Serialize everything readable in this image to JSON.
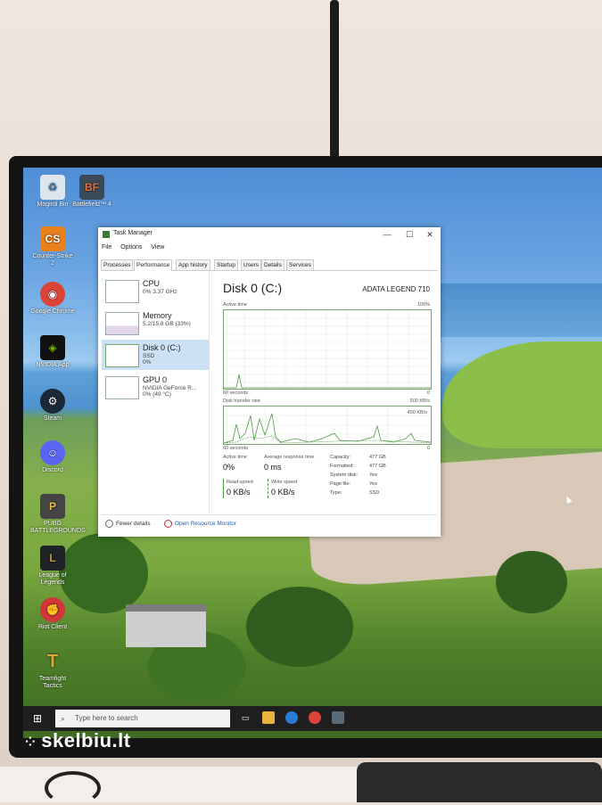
{
  "desktop": {
    "icons": [
      {
        "label": "Mogirdi Bin",
        "icon": "recycle-bin-icon",
        "color": "#dde6ee"
      },
      {
        "label": "Battlefield™ 4",
        "icon": "battlefield-icon",
        "color": "#3a4a5a"
      },
      {
        "label": "Counter-Strike 2",
        "icon": "counter-strike-icon",
        "color": "#e8801c"
      },
      {
        "label": "Google Chrome",
        "icon": "chrome-icon",
        "color": "#db4437"
      },
      {
        "label": "NVIDIA App",
        "icon": "nvidia-icon",
        "color": "#76b900"
      },
      {
        "label": "Steam",
        "icon": "steam-icon",
        "color": "#1b2838"
      },
      {
        "label": "Discord",
        "icon": "discord-icon",
        "color": "#5865f2"
      },
      {
        "label": "PUBG BATTLEGROUNDS",
        "icon": "pubg-icon",
        "color": "#444444"
      },
      {
        "label": "League of Legends",
        "icon": "league-icon",
        "color": "#1e2328"
      },
      {
        "label": "Riot Client",
        "icon": "riot-icon",
        "color": "#d13639"
      },
      {
        "label": "Teamfight Tactics",
        "icon": "tft-icon",
        "color": "#c89b3c"
      }
    ]
  },
  "taskbar": {
    "search_placeholder": "Type here to search",
    "start_glyph": "⊞",
    "search_glyph": "⌕"
  },
  "watermark": {
    "text": "skelbiu.lt",
    "dots": "⁘"
  },
  "taskmanager": {
    "title": "Task Manager",
    "controls": {
      "minimize": "—",
      "maximize": "☐",
      "close": "✕"
    },
    "menu": [
      "File",
      "Options",
      "View"
    ],
    "tabs": [
      "Processes",
      "Performance",
      "App history",
      "Startup",
      "Users",
      "Details",
      "Services"
    ],
    "active_tab": "Performance",
    "left_items": [
      {
        "name": "CPU",
        "sub1": "0% 3.37 GHz",
        "sub2": ""
      },
      {
        "name": "Memory",
        "sub1": "5.2/15.8 GB (33%)",
        "sub2": ""
      },
      {
        "name": "Disk 0 (C:)",
        "sub1": "SSD",
        "sub2": "0%"
      },
      {
        "name": "GPU 0",
        "sub1": "NVIDIA GeForce R...",
        "sub2": "0% (49 °C)"
      }
    ],
    "selected_index": 2,
    "detail": {
      "title": "Disk 0 (C:)",
      "model": "ADATA LEGEND 710",
      "graph1": {
        "label": "Active time",
        "max": "100%",
        "xlabel": "60 seconds",
        "xmin": "0"
      },
      "graph2": {
        "label": "Disk transfer rate",
        "max": "500 KB/s",
        "inner": "450 KB/s",
        "xlabel": "60 seconds",
        "xmin": "0"
      },
      "active_time_label": "Active time",
      "active_time": "0%",
      "avg_resp_label": "Average response time",
      "avg_resp": "0 ms",
      "read_label": "Read speed",
      "read": "0 KB/s",
      "write_label": "Write speed",
      "write": "0 KB/s",
      "props": [
        {
          "k": "Capacity:",
          "v": "477 GB"
        },
        {
          "k": "Formatted:",
          "v": "477 GB"
        },
        {
          "k": "System disk:",
          "v": "Yes"
        },
        {
          "k": "Page file:",
          "v": "Yes"
        },
        {
          "k": "Type:",
          "v": "SSD"
        }
      ]
    },
    "fewer_details": "Fewer details",
    "open_resource_monitor": "Open Resource Monitor",
    "graph_color": "#4f9a44"
  }
}
